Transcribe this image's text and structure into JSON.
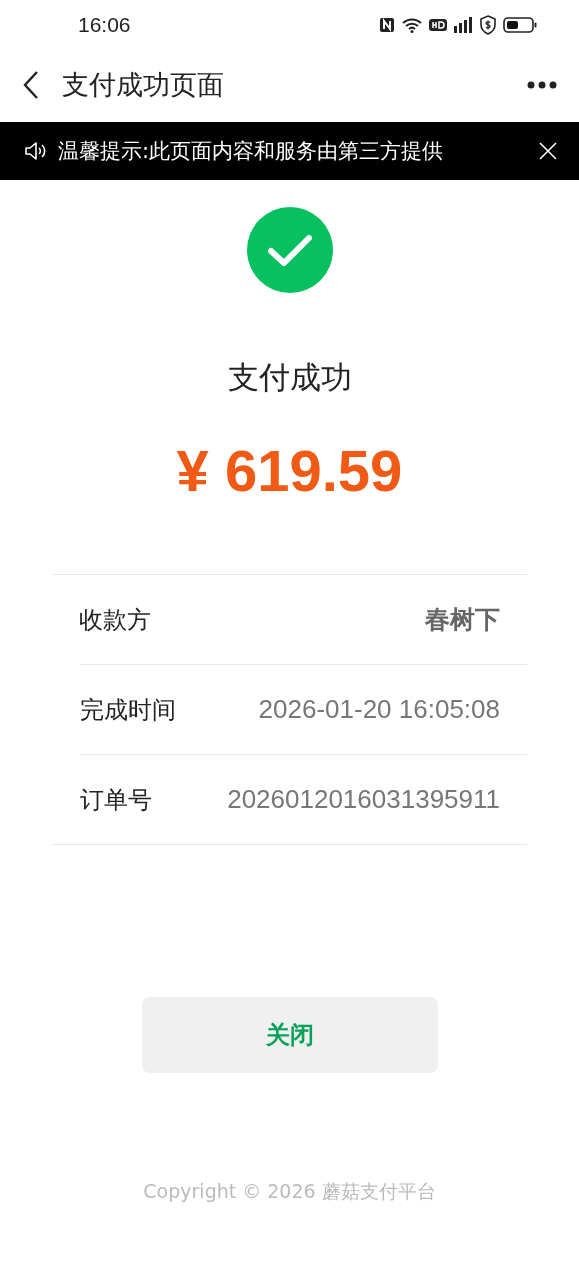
{
  "status_bar": {
    "time": "16:06"
  },
  "nav": {
    "title": "支付成功页面"
  },
  "notice": {
    "text": "温馨提示:此页面内容和服务由第三方提供"
  },
  "result": {
    "title": "支付成功",
    "amount": "¥ 619.59"
  },
  "details": [
    {
      "label": "收款方",
      "value": "春树下",
      "bold": true
    },
    {
      "label": "完成时间",
      "value": "2026-01-20 16:05:08",
      "bold": false
    },
    {
      "label": "订单号",
      "value": "2026012016031395911",
      "bold": false
    }
  ],
  "close_button": "关闭",
  "footer": "Copyright © 2026 蘑菇支付平台"
}
